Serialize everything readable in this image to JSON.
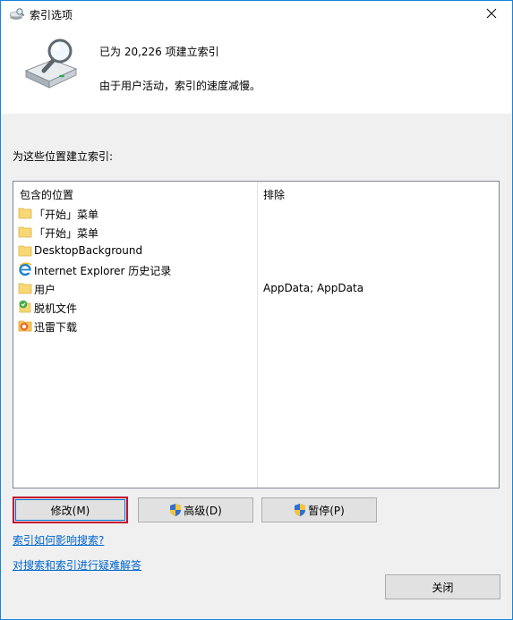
{
  "window": {
    "title": "索引选项",
    "close_glyph": "✕"
  },
  "status": {
    "indexed_count_text": "已为 20,226 项建立索引",
    "activity_text": "由于用户活动，索引的速度减慢。"
  },
  "locations_label": "为这些位置建立索引:",
  "table": {
    "header_location": "包含的位置",
    "header_exclude": "排除",
    "rows": [
      {
        "icon": "folder-icon",
        "location": "「开始」菜单",
        "exclude": ""
      },
      {
        "icon": "folder-icon",
        "location": "「开始」菜单",
        "exclude": ""
      },
      {
        "icon": "folder-icon",
        "location": "DesktopBackground",
        "exclude": ""
      },
      {
        "icon": "ie-icon",
        "location": "Internet Explorer 历史记录",
        "exclude": ""
      },
      {
        "icon": "folder-icon",
        "location": "用户",
        "exclude": "AppData; AppData"
      },
      {
        "icon": "offline-files-icon",
        "location": "脱机文件",
        "exclude": ""
      },
      {
        "icon": "thunder-icon",
        "location": "迅雷下载",
        "exclude": ""
      }
    ]
  },
  "buttons": {
    "modify": "修改(M)",
    "advanced": "高级(D)",
    "pause": "暂停(P)",
    "close": "关闭"
  },
  "links": {
    "how_affects": "索引如何影响搜索?",
    "troubleshoot": "对搜索和索引进行疑难解答"
  },
  "colors": {
    "accent": "#0078d7",
    "highlight_border": "#c8102e",
    "link": "#0066cc",
    "folder": "#f8d775"
  }
}
